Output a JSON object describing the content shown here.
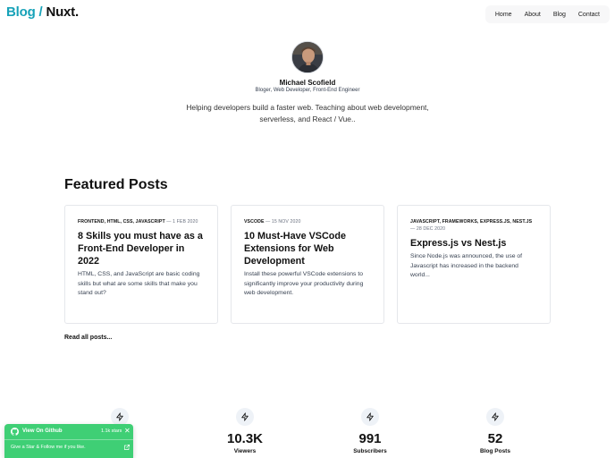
{
  "header": {
    "logo_part1": "Blog",
    "logo_sep": " / ",
    "logo_part2": "Nuxt.",
    "nav": [
      "Home",
      "About",
      "Blog",
      "Contact"
    ]
  },
  "profile": {
    "name": "Michael Scofield",
    "role": "Bloger, Web Developer, Front-End Engineer",
    "tagline": "Helping developers build a faster web. Teaching about web development, serverless, and React / Vue.."
  },
  "featured": {
    "title": "Featured Posts",
    "posts": [
      {
        "tags": "FRONTEND, HTML, CSS, JAVASCRIPT",
        "date": "1 FEB 2020",
        "title": "8 Skills you must have as a Front-End Developer in 2022",
        "desc": "HTML, CSS, and JavaScript are basic coding skills but what are some skills that make you stand out?"
      },
      {
        "tags": "VSCODE",
        "date": "15 NOV 2020",
        "title": "10 Must-Have VSCode Extensions for Web Development",
        "desc": "Install these powerful VSCode extensions to significantly improve your productivity during web development."
      },
      {
        "tags": "JAVASCRIPT, FRAMEWORKS, EXPRESS.JS, NEST.JS",
        "date": "28 DEC 2020",
        "title": "Express.js vs Nest.js",
        "desc": "Since Node.js was announced, the use of Javascript has increased in the backend world..."
      }
    ],
    "read_all": "Read all posts..."
  },
  "stats": [
    {
      "value": "",
      "label": "ost",
      "icon": "bolt-icon"
    },
    {
      "value": "10.3K",
      "label": "Viewers",
      "icon": "bolt-icon"
    },
    {
      "value": "991",
      "label": "Subscribers",
      "icon": "bolt-icon"
    },
    {
      "value": "52",
      "label": "Blog Posts",
      "icon": "bolt-icon"
    }
  ],
  "github_popup": {
    "title": "View On Github",
    "stars": "1.1k stars",
    "close": "✕",
    "message": "Give a Star & Follow me if you like.",
    "color": "#3fcf75"
  },
  "colors": {
    "accent": "#17a2b8"
  }
}
